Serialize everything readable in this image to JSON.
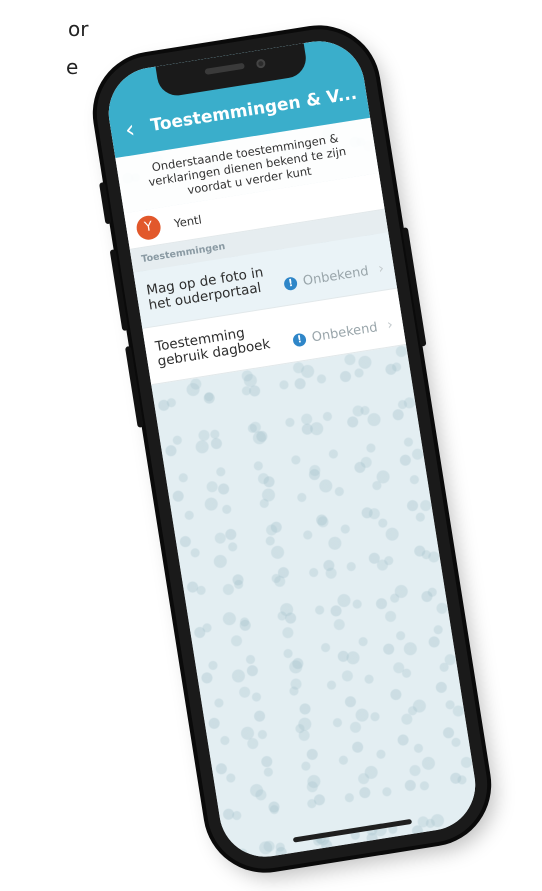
{
  "background_text": {
    "line1": "or",
    "line2": "e"
  },
  "app": {
    "header": {
      "title": "Toestemmingen & V...",
      "back_icon": "chevron-left-icon",
      "color": "#3aaecb"
    },
    "intro": "Onderstaande toestemmingen & verklaringen dienen bekend te zijn voordat u verder kunt",
    "child": {
      "initial": "Y",
      "name": "Yentl",
      "avatar_color": "#e2582b"
    },
    "section_title": "Toestemmingen",
    "permissions": [
      {
        "label": "Mag op de foto in het ouderportaal",
        "status": "Onbekend",
        "status_icon": "info-icon"
      },
      {
        "label": "Toestemming gebruik dagboek",
        "status": "Onbekend",
        "status_icon": "info-icon"
      }
    ],
    "info_glyph": "!",
    "chevron_glyph": "›",
    "back_glyph": "‹"
  }
}
